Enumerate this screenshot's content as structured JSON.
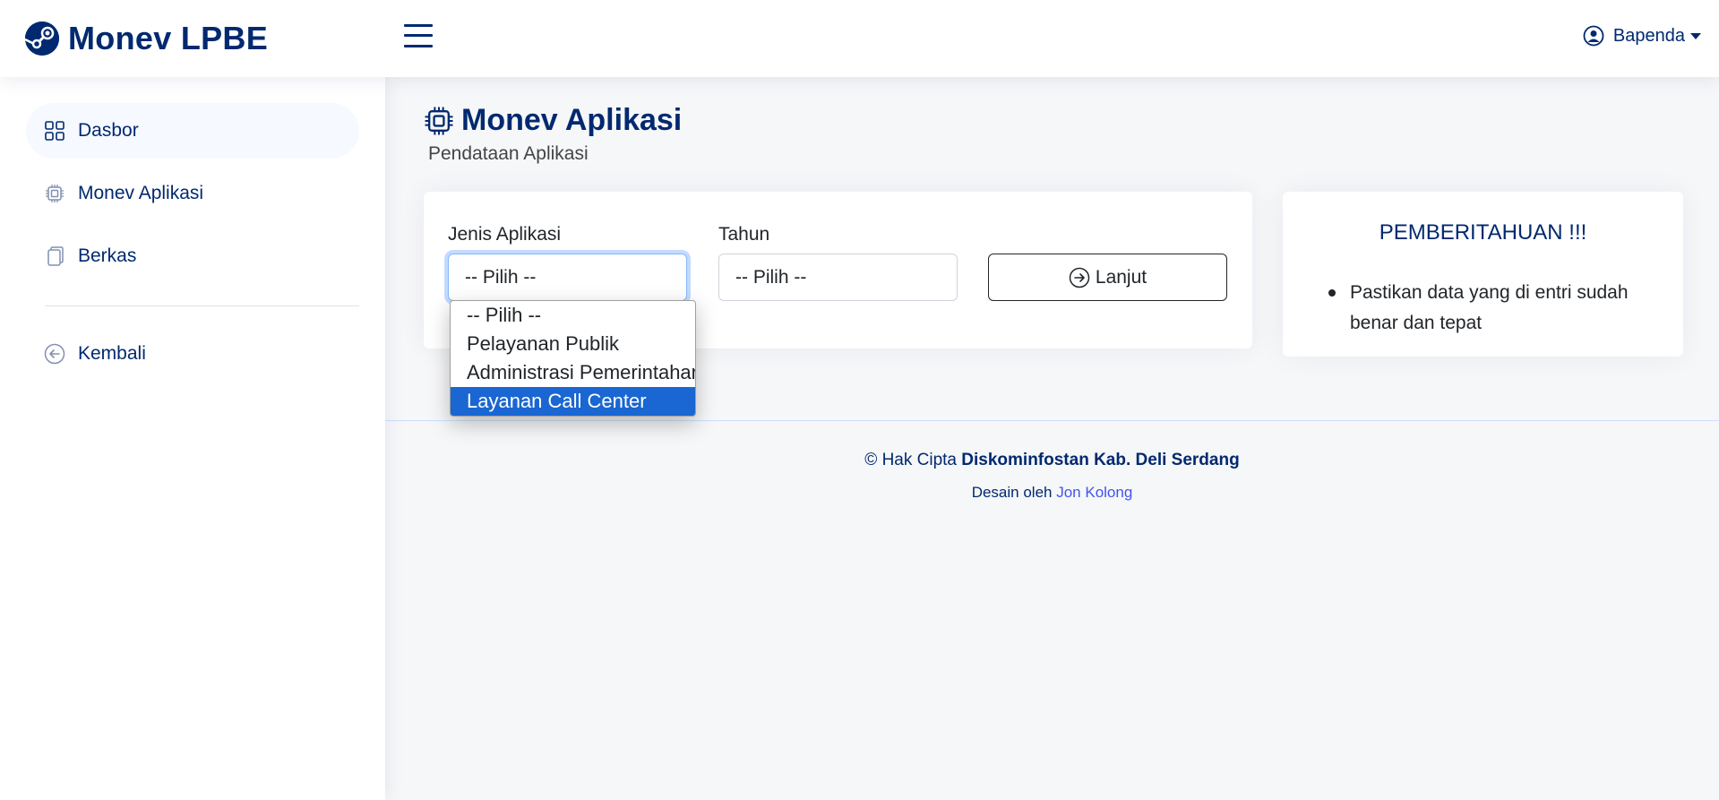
{
  "app": {
    "title": "Monev LPBE"
  },
  "header": {
    "user_name": "Bapenda"
  },
  "sidebar": {
    "items": [
      {
        "label": "Dasbor",
        "icon": "grid-icon",
        "active": true
      },
      {
        "label": "Monev Aplikasi",
        "icon": "cpu-icon",
        "active": false
      },
      {
        "label": "Berkas",
        "icon": "files-icon",
        "active": false
      }
    ],
    "back": {
      "label": "Kembali",
      "icon": "arrow-left-circle-icon"
    }
  },
  "page": {
    "title": "Monev Aplikasi",
    "subtitle": "Pendataan Aplikasi"
  },
  "form": {
    "jenis_label": "Jenis Aplikasi",
    "jenis_value": "-- Pilih --",
    "tahun_label": "Tahun",
    "tahun_value": "-- Pilih --",
    "submit_label": "Lanjut",
    "jenis_options": [
      "-- Pilih --",
      "Pelayanan Publik",
      "Administrasi Pemerintahan",
      "Layanan Call Center"
    ],
    "highlighted_option": "Layanan Call Center"
  },
  "notice": {
    "title": "PEMBERITAHUAN !!!",
    "items": [
      "Pastikan data yang di entri sudah benar dan tepat"
    ]
  },
  "footer": {
    "copyright_prefix": "© Hak Cipta",
    "copyright_owner": "Diskominfostan Kab. Deli Serdang",
    "design_prefix": "Desain oleh",
    "design_author": "Jon Kolong"
  },
  "colors": {
    "primary": "#012970",
    "link": "#4154f1",
    "highlight": "#1a66d2",
    "background": "#f6f7f8"
  }
}
